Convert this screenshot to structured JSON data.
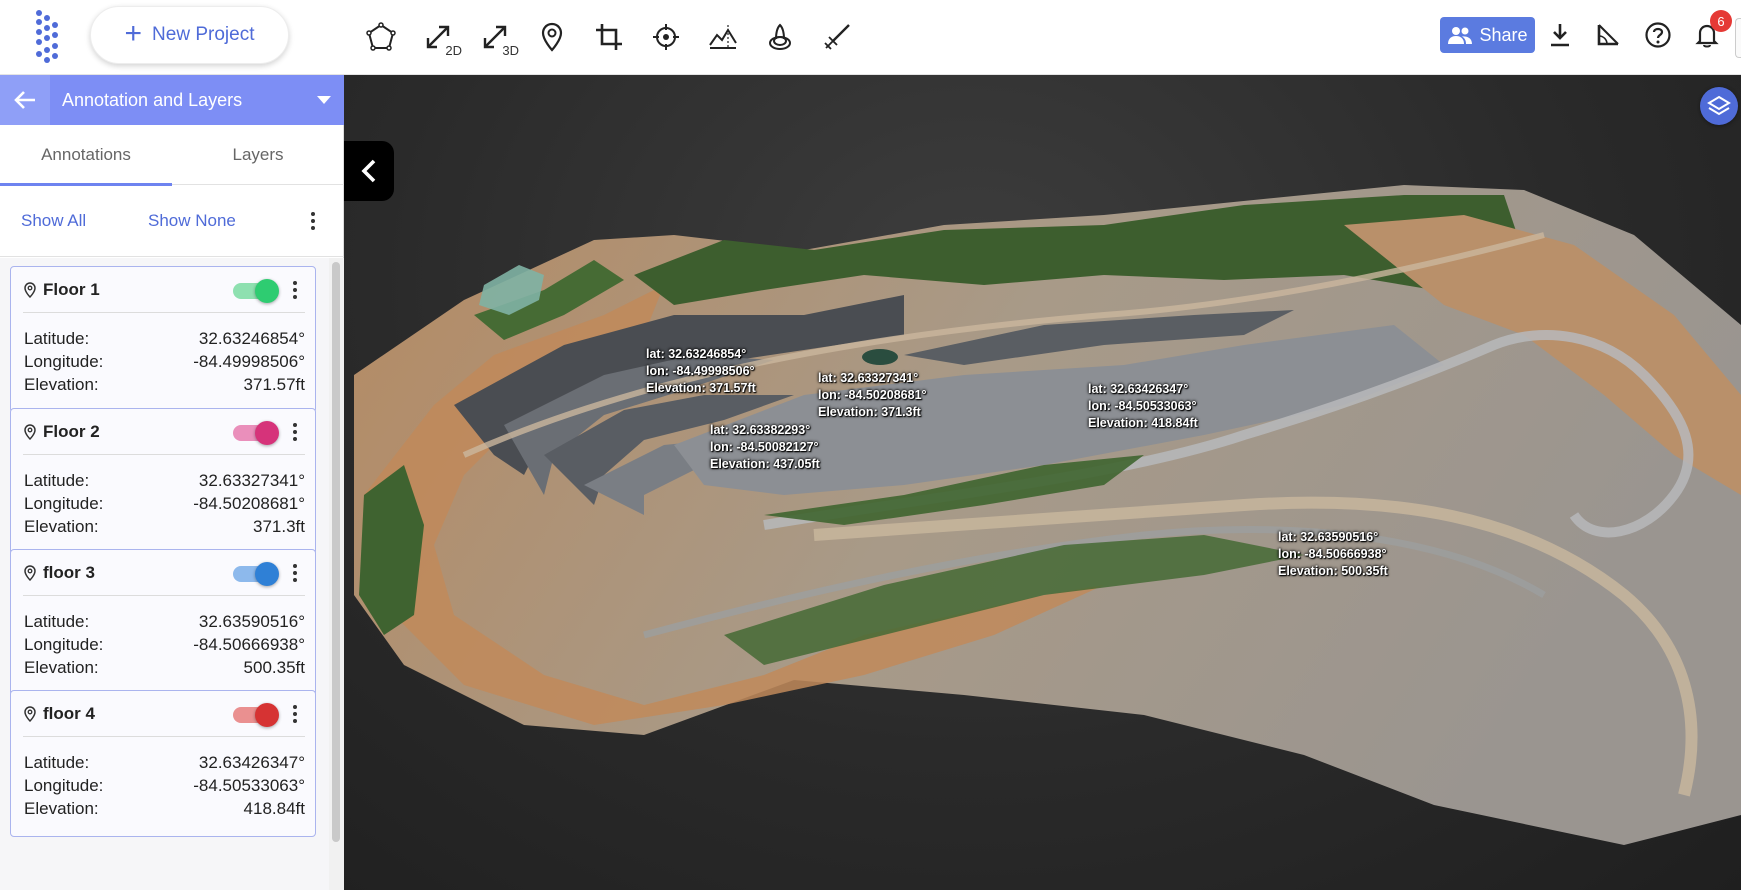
{
  "toolbar": {
    "new_project_label": "New Project",
    "tools": [
      {
        "icon": "polygon-icon",
        "sub": ""
      },
      {
        "icon": "measure-distance-icon",
        "sub": "2D"
      },
      {
        "icon": "measure-distance-icon",
        "sub": "3D"
      },
      {
        "icon": "location-pin-icon",
        "sub": ""
      },
      {
        "icon": "crop-icon",
        "sub": ""
      },
      {
        "icon": "target-icon",
        "sub": ""
      },
      {
        "icon": "terrain-profile-icon",
        "sub": ""
      },
      {
        "icon": "volume-icon",
        "sub": ""
      },
      {
        "icon": "brush-icon",
        "sub": ""
      }
    ],
    "share_label": "Share",
    "notification_count": "6"
  },
  "panel": {
    "title": "Annotation and Layers",
    "tabs": [
      {
        "label": "Annotations",
        "active": true
      },
      {
        "label": "Layers",
        "active": false
      }
    ],
    "show_all_label": "Show All",
    "show_none_label": "Show None",
    "annotations": [
      {
        "name": "Floor 1",
        "color": "#2ecc71",
        "track": "#8ee0b0",
        "enabled": true,
        "rows": [
          {
            "label": "Latitude:",
            "value": "32.63246854°"
          },
          {
            "label": "Longitude:",
            "value": "-84.49998506°"
          },
          {
            "label": "Elevation:",
            "value": "371.57ft"
          }
        ]
      },
      {
        "name": "Floor 2",
        "color": "#d6337a",
        "track": "#ea8fbb",
        "enabled": true,
        "rows": [
          {
            "label": "Latitude:",
            "value": "32.63327341°"
          },
          {
            "label": "Longitude:",
            "value": "-84.50208681°"
          },
          {
            "label": "Elevation:",
            "value": "371.3ft"
          }
        ]
      },
      {
        "name": "floor 3",
        "color": "#2f80d6",
        "track": "#8db9ec",
        "enabled": true,
        "rows": [
          {
            "label": "Latitude:",
            "value": "32.63590516°"
          },
          {
            "label": "Longitude:",
            "value": "-84.50666938°"
          },
          {
            "label": "Elevation:",
            "value": "500.35ft"
          }
        ]
      },
      {
        "name": "floor 4",
        "color": "#d63333",
        "track": "#ea9090",
        "enabled": true,
        "rows": [
          {
            "label": "Latitude:",
            "value": "32.63426347°"
          },
          {
            "label": "Longitude:",
            "value": "-84.50533063°"
          },
          {
            "label": "Elevation:",
            "value": "418.84ft"
          }
        ]
      }
    ]
  },
  "viewer": {
    "labels": [
      {
        "lat": "lat: 32.63246854°",
        "lon": "lon: -84.49998506°",
        "elev": "Elevation: 371.57ft"
      },
      {
        "lat": "lat: 32.63327341°",
        "lon": "lon: -84.50208681°",
        "elev": "Elevation: 371.3ft"
      },
      {
        "lat": "lat: 32.63382293°",
        "lon": "lon: -84.50082127°",
        "elev": "Elevation: 437.05ft"
      },
      {
        "lat": "lat: 32.63426347°",
        "lon": "lon: -84.50533063°",
        "elev": "Elevation: 418.84ft"
      },
      {
        "lat": "lat: 32.63590516°",
        "lon": "lon: -84.50666938°",
        "elev": "Elevation: 500.35ft"
      }
    ]
  },
  "colors": {
    "accent": "#4f6bd8",
    "panel_header": "#7d8ef5"
  }
}
